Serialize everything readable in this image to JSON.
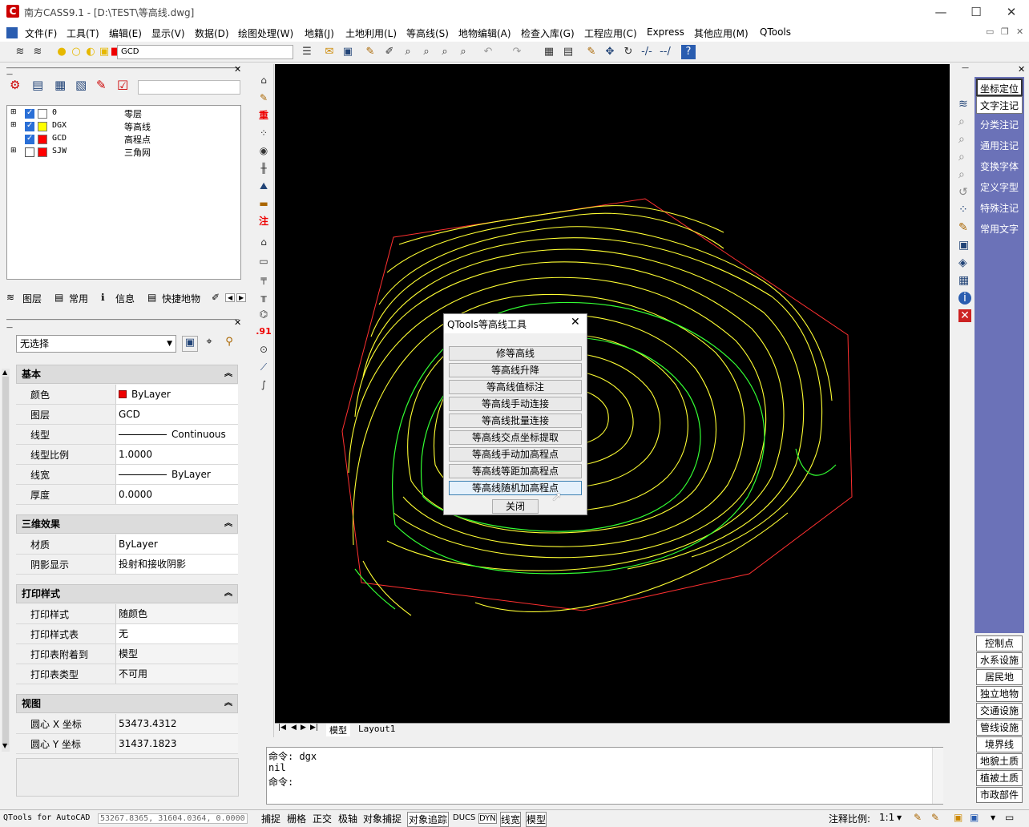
{
  "app": {
    "title": "南方CASS9.1 - [D:\\TEST\\等高线.dwg]",
    "logo": "C"
  },
  "window": {
    "minimize": "—",
    "maximize": "☐",
    "close": "✕"
  },
  "menu": [
    "文件(F)",
    "工具(T)",
    "编辑(E)",
    "显示(V)",
    "数据(D)",
    "绘图处理(W)",
    "地籍(J)",
    "土地利用(L)",
    "等高线(S)",
    "地物编辑(A)",
    "检查入库(G)",
    "工程应用(C)",
    "Express",
    "其他应用(M)",
    "QTools"
  ],
  "toolbar": {
    "layer": "GCD"
  },
  "layers": [
    {
      "name": "0",
      "desc": "零层",
      "color": "#ffffff",
      "on": true
    },
    {
      "name": "DGX",
      "desc": "等高线",
      "color": "#ffff00",
      "on": true
    },
    {
      "name": "GCD",
      "desc": "高程点",
      "color": "#ff0000",
      "on": true
    },
    {
      "name": "SJW",
      "desc": "三角网",
      "color": "#ff0000",
      "on": false
    }
  ],
  "panel_tabs": [
    "图层",
    "常用",
    "信息",
    "快捷地物"
  ],
  "props": {
    "selection": "无选择",
    "sections": {
      "basic": "基本",
      "three_d": "三维效果",
      "plot": "打印样式",
      "view": "视图"
    },
    "basic": [
      [
        "颜色",
        "ByLayer"
      ],
      [
        "图层",
        "GCD"
      ],
      [
        "线型",
        "Continuous"
      ],
      [
        "线型比例",
        "1.0000"
      ],
      [
        "线宽",
        "ByLayer"
      ],
      [
        "厚度",
        "0.0000"
      ]
    ],
    "three_d": [
      [
        "材质",
        "ByLayer"
      ],
      [
        "阴影显示",
        "投射和接收阴影"
      ]
    ],
    "plot": [
      [
        "打印样式",
        "随颜色"
      ],
      [
        "打印样式表",
        "无"
      ],
      [
        "打印表附着到",
        "模型"
      ],
      [
        "打印表类型",
        "不可用"
      ]
    ],
    "view": [
      [
        "圆心 X 坐标",
        "53473.4312"
      ],
      [
        "圆心 Y 坐标",
        "31437.1823"
      ]
    ]
  },
  "vtools": [
    "重",
    "注",
    ".91"
  ],
  "dialog": {
    "title": "QTools等高线工具",
    "buttons": [
      "修等高线",
      "等高线升降",
      "等高线值标注",
      "等高线手动连接",
      "等高线批量连接",
      "等高线交点坐标提取",
      "等高线手动加高程点",
      "等高线等距加高程点",
      "等高线随机加高程点"
    ],
    "close": "关闭"
  },
  "layout_tabs": [
    "模型",
    "Layout1"
  ],
  "command": [
    "命令: dgx",
    "nil",
    "命令:"
  ],
  "right_top": [
    "坐标定位",
    "文字注记",
    "分类注记",
    "通用注记",
    "变换字体",
    "定义字型",
    "特殊注记",
    "常用文字"
  ],
  "right_bottom": [
    "控制点",
    "水系设施",
    "居民地",
    "独立地物",
    "交通设施",
    "管线设施",
    "境界线",
    "地貌土质",
    "植被土质",
    "市政部件"
  ],
  "status": {
    "app": "QTools for AutoCAD",
    "coords": "53267.8365, 31604.0364, 0.0000",
    "toggles": [
      "捕捉",
      "栅格",
      "正交",
      "极轴",
      "对象捕捉",
      "对象追踪",
      "DUCS",
      "DYN",
      "线宽",
      "模型"
    ],
    "scale_label": "注释比例:",
    "scale": "1:1"
  },
  "colors": {
    "canvas": "#000000",
    "contour": "#ffff00",
    "index_contour": "#00ff00",
    "boundary": "#ff0000",
    "right_panel": "#6b72b8"
  }
}
